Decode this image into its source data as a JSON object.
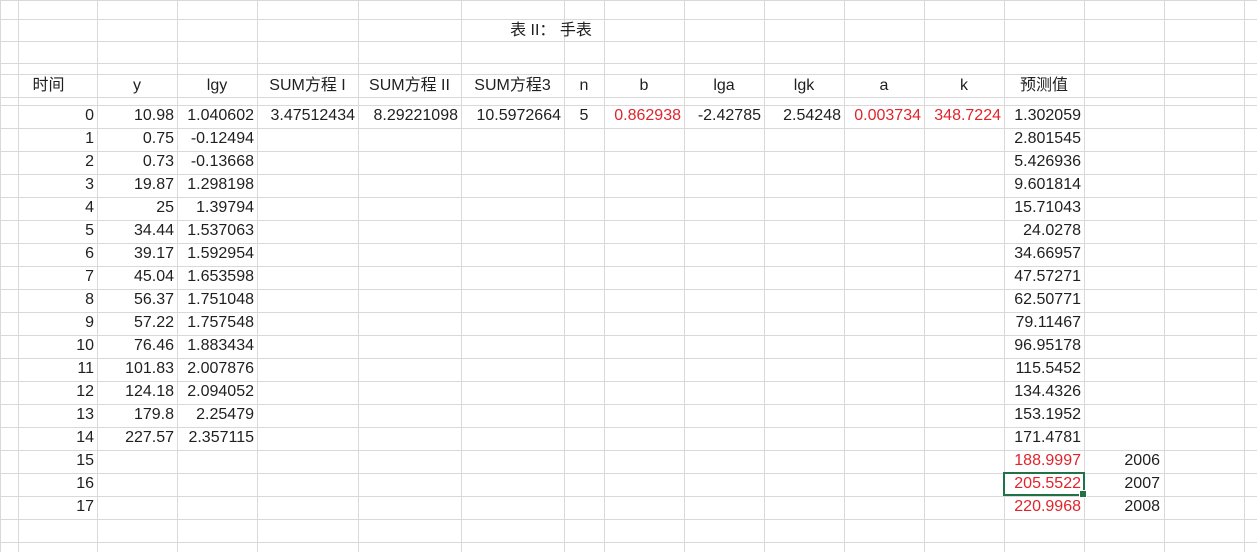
{
  "sheet": {
    "title": "表 II： 手表",
    "headers": [
      "时间",
      "y",
      "lgy",
      "SUM方程 I",
      "SUM方程 II",
      "SUM方程3",
      "n",
      "b",
      "lga",
      "lgk",
      "a",
      "k",
      "预测值"
    ],
    "params": {
      "sum1": "3.47512434",
      "sum2": "8.29221098",
      "sum3": "10.5972664",
      "n": "5",
      "b": "0.862938",
      "lga": "-2.42785",
      "lgk": "2.54248",
      "a": "0.003734",
      "k": "348.7224"
    },
    "time": [
      "0",
      "1",
      "2",
      "3",
      "4",
      "5",
      "6",
      "7",
      "8",
      "9",
      "10",
      "11",
      "12",
      "13",
      "14",
      "15",
      "16",
      "17"
    ],
    "y": [
      "10.98",
      "0.75",
      "0.73",
      "19.87",
      "25",
      "34.44",
      "39.17",
      "45.04",
      "56.37",
      "57.22",
      "76.46",
      "101.83",
      "124.18",
      "179.8",
      "227.57"
    ],
    "lgy": [
      "1.040602",
      "-0.12494",
      "-0.13668",
      "1.298198",
      "1.39794",
      "1.537063",
      "1.592954",
      "1.653598",
      "1.751048",
      "1.757548",
      "1.883434",
      "2.007876",
      "2.094052",
      "2.25479",
      "2.357115"
    ],
    "forecast": [
      "1.302059",
      "2.801545",
      "5.426936",
      "9.601814",
      "15.71043",
      "24.0278",
      "34.66957",
      "47.57271",
      "62.50771",
      "79.11467",
      "96.95178",
      "115.5452",
      "134.4326",
      "153.1952",
      "171.4781",
      "188.9997",
      "205.5522",
      "220.9968"
    ],
    "years": [
      "2006",
      "2007",
      "2008"
    ],
    "colors": {
      "red": "#e0242b",
      "gridline": "#d9d9d9",
      "selection": "#217346"
    }
  }
}
